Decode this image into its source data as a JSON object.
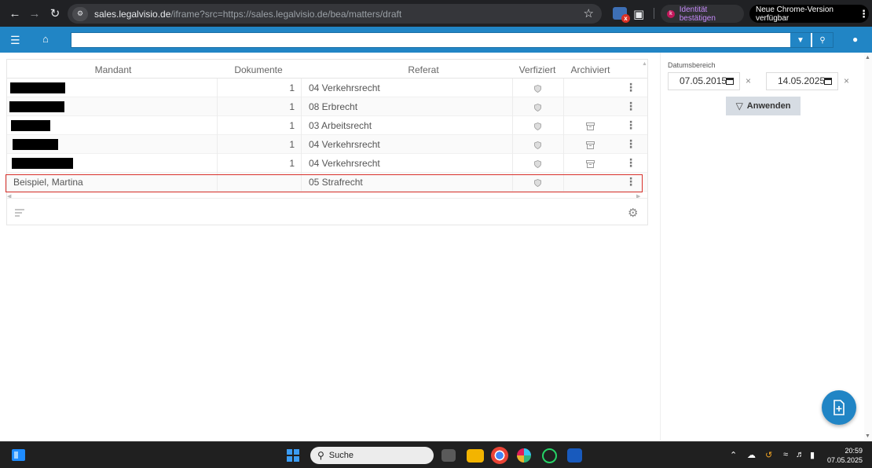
{
  "browser": {
    "url_host": "sales.legalvisio.de",
    "url_rest": "/iframe?src=https://sales.legalvisio.de/bea/matters/draft",
    "identity_label": "Identität bestätigen",
    "update_label": "Neue Chrome-Version verfügbar"
  },
  "header": {
    "search_placeholder": ""
  },
  "table": {
    "columns": {
      "mandant": "Mandant",
      "dokumente": "Dokumente",
      "referat": "Referat",
      "verfiziert": "Verfiziert",
      "archiviert": "Archiviert"
    },
    "rows": [
      {
        "mandant": "",
        "dokumente": "1",
        "referat": "04 Verkehrsrecht",
        "archived": false
      },
      {
        "mandant": "",
        "dokumente": "1",
        "referat": "08 Erbrecht",
        "archived": false
      },
      {
        "mandant": "",
        "dokumente": "1",
        "referat": "03 Arbeitsrecht",
        "archived": true
      },
      {
        "mandant": "",
        "dokumente": "1",
        "referat": "04 Verkehrsrecht",
        "archived": true
      },
      {
        "mandant": "",
        "dokumente": "1",
        "referat": "04 Verkehrsrecht",
        "archived": true
      },
      {
        "mandant": "Beispiel, Martina",
        "dokumente": "",
        "referat": "05 Strafrecht",
        "archived": false
      }
    ]
  },
  "filter": {
    "range_label": "Datumsbereich",
    "date_from": "07.05.2015",
    "date_to": "14.05.2025",
    "apply_label": "Anwenden"
  },
  "taskbar": {
    "search_label": "Suche",
    "time": "20:59",
    "date": "07.05.2025"
  }
}
